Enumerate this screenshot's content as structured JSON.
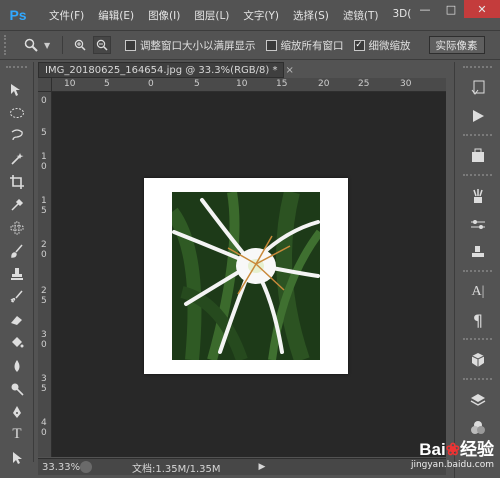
{
  "app": {
    "logo": "Ps"
  },
  "menu": [
    "文件(F)",
    "编辑(E)",
    "图像(I)",
    "图层(L)",
    "文字(Y)",
    "选择(S)",
    "滤镜(T)",
    "3D("
  ],
  "window_controls": {
    "minimize": "—",
    "maximize": "□",
    "close": "✕"
  },
  "options": {
    "resize_windows": "调整窗口大小以满屏显示",
    "resize_checked": false,
    "zoom_all_windows": "缩放所有窗口",
    "zoom_all_checked": false,
    "scrubby_zoom": "细微缩放",
    "scrubby_checked": true,
    "actual_pixels": "实际像素"
  },
  "document": {
    "tab_title": "IMG_20180625_164654.jpg @ 33.3%(RGB/8) *",
    "close_glyph": "×"
  },
  "ruler": {
    "h_ticks": [
      "10",
      "5",
      "0",
      "5",
      "10",
      "15",
      "20",
      "25",
      "30"
    ],
    "v_ticks": [
      "0",
      "5",
      "1",
      "0",
      "1",
      "5",
      "2",
      "0",
      "2",
      "5",
      "3",
      "0",
      "3",
      "5",
      "4",
      "0"
    ]
  },
  "status": {
    "zoom": "33.33%",
    "doc_info": "文档:1.35M/1.35M",
    "arrow": "▶"
  },
  "watermark": {
    "brand_prefix": "Bai",
    "brand_suffix": "经验",
    "url": "jingyan.baidu.com"
  },
  "icons": {
    "move": "move-icon",
    "marquee": "ellipse-marquee-icon",
    "lasso": "lasso-icon",
    "wand": "magic-wand-icon",
    "crop": "crop-icon",
    "eyedropper": "eyedropper-icon",
    "heal": "healing-brush-icon",
    "brush": "brush-icon",
    "stamp": "clone-stamp-icon",
    "history": "history-brush-icon",
    "eraser": "eraser-icon",
    "bucket": "paint-bucket-icon",
    "blur": "blur-icon",
    "dodge": "dodge-icon",
    "pen": "pen-icon",
    "type": "type-icon",
    "select": "path-select-icon"
  }
}
